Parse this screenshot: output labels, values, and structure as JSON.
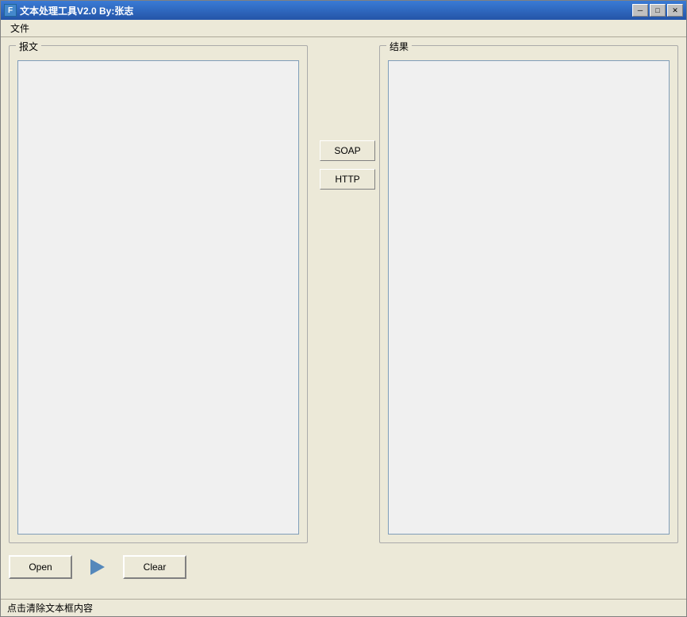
{
  "window": {
    "title": "文本处理工具V2.0 By:张志",
    "icon_char": "F"
  },
  "titlebar": {
    "minimize_label": "─",
    "maximize_label": "□",
    "close_label": "✕"
  },
  "menu": {
    "items": [
      {
        "label": "文件"
      }
    ]
  },
  "left_panel": {
    "legend": "报文",
    "textarea_placeholder": ""
  },
  "right_panel": {
    "legend": "结果",
    "textarea_placeholder": ""
  },
  "middle_buttons": {
    "soap_label": "SOAP",
    "http_label": "HTTP"
  },
  "bottom_buttons": {
    "open_label": "Open",
    "clear_label": "Clear"
  },
  "status_bar": {
    "text": "点击清除文本框内容"
  }
}
